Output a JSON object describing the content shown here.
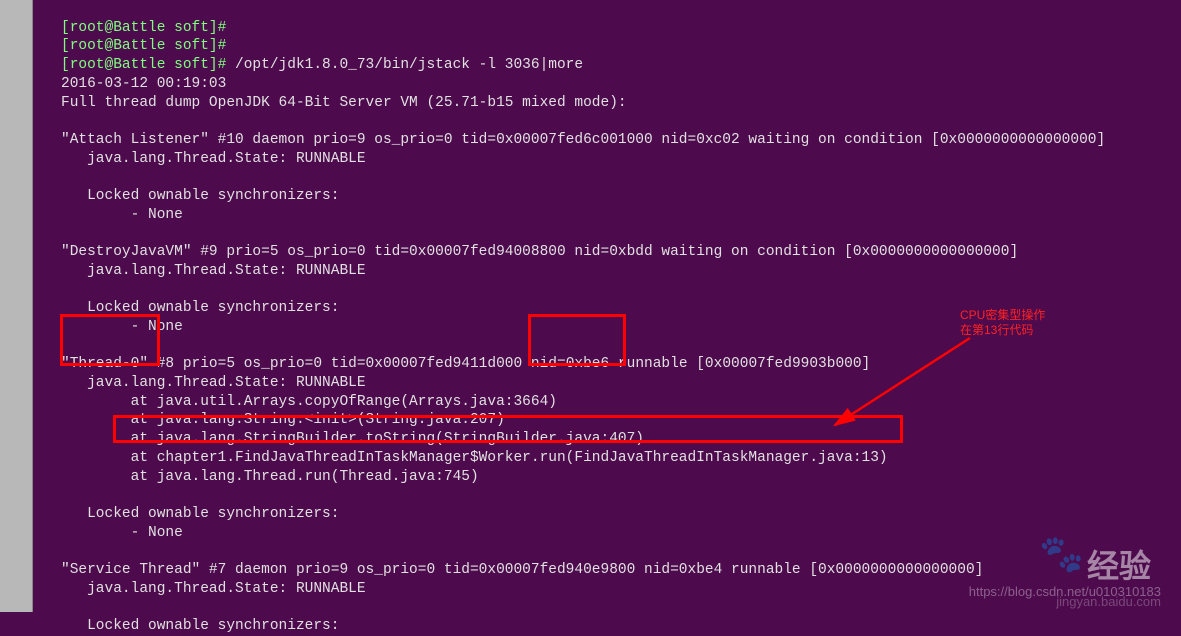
{
  "prompts": {
    "p0": "[root@Battle soft]#",
    "p1": "[root@Battle soft]#",
    "p2": "[root@Battle soft]# ",
    "cmd": "/opt/jdk1.8.0_73/bin/jstack -l 3036|more"
  },
  "header": {
    "date": "2016-03-12 00:19:03",
    "dump": "Full thread dump OpenJDK 64-Bit Server VM (25.71-b15 mixed mode):"
  },
  "threads": {
    "attach": {
      "title": "\"Attach Listener\" #10 daemon prio=9 os_prio=0 tid=0x00007fed6c001000 nid=0xc02 waiting on condition [0x0000000000000000]",
      "state": "   java.lang.Thread.State: RUNNABLE",
      "lock1": "   Locked ownable synchronizers:",
      "lock2": "        - None"
    },
    "destroy": {
      "title": "\"DestroyJavaVM\" #9 prio=5 os_prio=0 tid=0x00007fed94008800 nid=0xbdd waiting on condition [0x0000000000000000]",
      "state": "   java.lang.Thread.State: RUNNABLE",
      "lock1": "   Locked ownable synchronizers:",
      "lock2": "        - None"
    },
    "thread0": {
      "title_pre": "\"Thread-0\"",
      "title_mid": " #8 prio=5 os_prio=0 tid=0x00007fed9411d000 ",
      "title_nid": "nid=0xbe6",
      "title_post": " runnable [0x00007fed9903b000]",
      "state": "   java.lang.Thread.State: RUNNABLE",
      "s1": "        at java.util.Arrays.copyOfRange(Arrays.java:3664)",
      "s2": "        at java.lang.String.<init>(String.java:207)",
      "s3": "        at java.lang.StringBuilder.toString(StringBuilder.java:407)",
      "s4": "        at chapter1.FindJavaThreadInTaskManager$Worker.run(FindJavaThreadInTaskManager.java:13)",
      "s5": "        at java.lang.Thread.run(Thread.java:745)",
      "lock1": "   Locked ownable synchronizers:",
      "lock2": "        - None"
    },
    "service": {
      "title": "\"Service Thread\" #7 daemon prio=9 os_prio=0 tid=0x00007fed940e9800 nid=0xbe4 runnable [0x0000000000000000]",
      "state": "   java.lang.Thread.State: RUNNABLE",
      "lock1": "   Locked ownable synchronizers:"
    }
  },
  "annotation": {
    "line1": "CPU密集型操作",
    "line2": "在第13行代码"
  },
  "watermark": {
    "url_top": "https://blog.csdn.net/u010310183",
    "logo_text": "经验",
    "url_bottom": "jingyan.baidu.com"
  },
  "colors": {
    "bg": "#4d0a4d",
    "prompt": "#7fff7f",
    "highlight": "#ff0000"
  }
}
